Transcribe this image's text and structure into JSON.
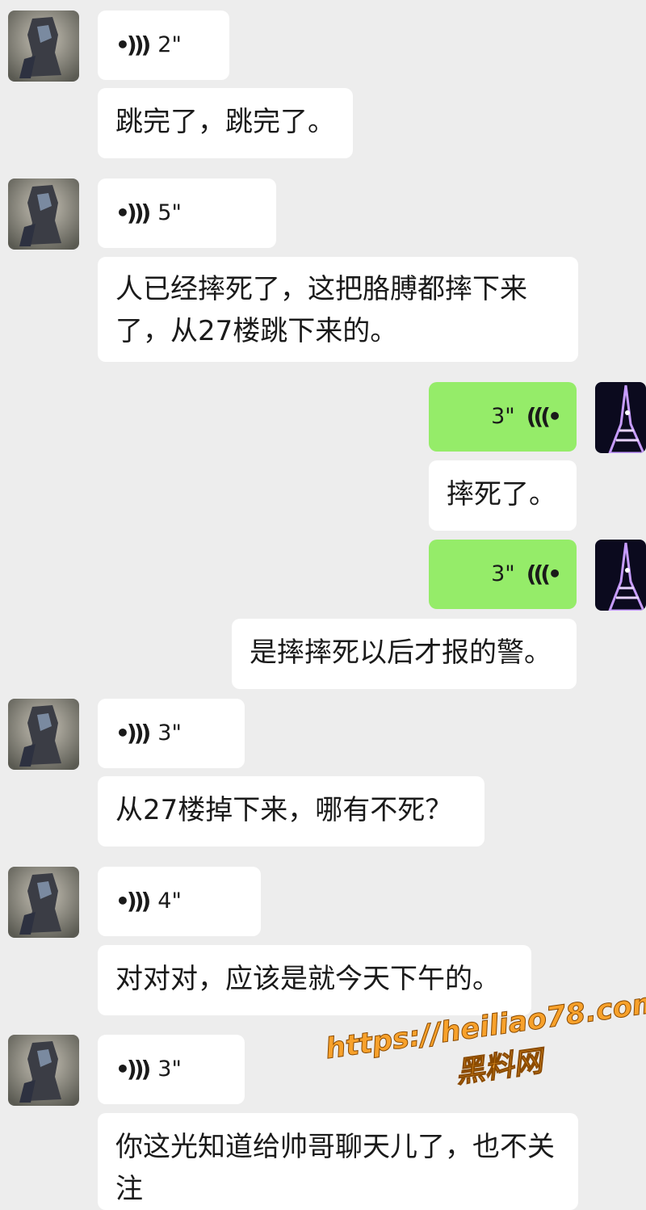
{
  "messages": [
    {
      "side": "left",
      "type": "voice",
      "duration": "2\""
    },
    {
      "side": "left",
      "type": "text",
      "text": "跳完了，跳完了。"
    },
    {
      "side": "left",
      "type": "voice",
      "duration": "5\""
    },
    {
      "side": "left",
      "type": "text",
      "text": "人已经摔死了，这把胳膊都摔下来了，从27楼跳下来的。"
    },
    {
      "side": "right",
      "type": "voice",
      "duration": "3\""
    },
    {
      "side": "right",
      "type": "text",
      "text": "摔死了。"
    },
    {
      "side": "right",
      "type": "voice",
      "duration": "3\""
    },
    {
      "side": "right",
      "type": "text",
      "text": "是摔摔死以后才报的警。"
    },
    {
      "side": "left",
      "type": "voice",
      "duration": "3\""
    },
    {
      "side": "left",
      "type": "text",
      "text": "从27楼掉下来，哪有不死？"
    },
    {
      "side": "left",
      "type": "voice",
      "duration": "4\""
    },
    {
      "side": "left",
      "type": "text",
      "text": "对对对，应该是就今天下午的。"
    },
    {
      "side": "left",
      "type": "voice",
      "duration": "3\""
    },
    {
      "side": "left",
      "type": "text",
      "text": "你这光知道给帅哥聊天儿了，也不关注"
    }
  ],
  "watermark": {
    "url": "https://heiliao78.com",
    "name": "黑料网"
  },
  "colors": {
    "background": "#ededed",
    "sent_bubble": "#95ec69",
    "received_bubble": "#ffffff"
  },
  "icons": {
    "received_voice": "voice-wave-icon",
    "sent_voice": "voice-wave-icon"
  }
}
